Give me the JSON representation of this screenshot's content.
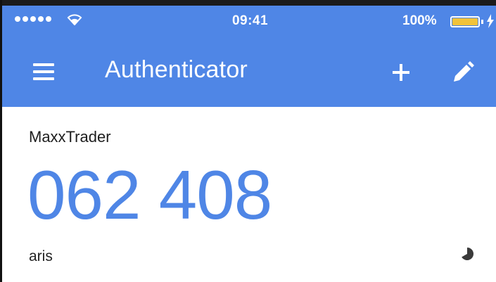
{
  "status_bar": {
    "time": "09:41",
    "battery_percent": "100%",
    "battery_fill_fraction": 1.0,
    "signal_bars": 5,
    "icons": [
      "signal-dots-icon",
      "wifi-icon",
      "battery-icon",
      "charging-bolt-icon"
    ]
  },
  "app_bar": {
    "title": "Authenticator",
    "icons": [
      "menu-icon",
      "add-icon",
      "edit-icon"
    ]
  },
  "accounts": [
    {
      "issuer": "MaxxTrader",
      "code": "062 408",
      "account_name": "aris",
      "timer_icon": "countdown-timer-icon"
    }
  ],
  "colors": {
    "primary": "#4f86e6",
    "code_text": "#4f86e6",
    "battery_fill": "#f2c33a",
    "text": "#1e1e1e"
  }
}
